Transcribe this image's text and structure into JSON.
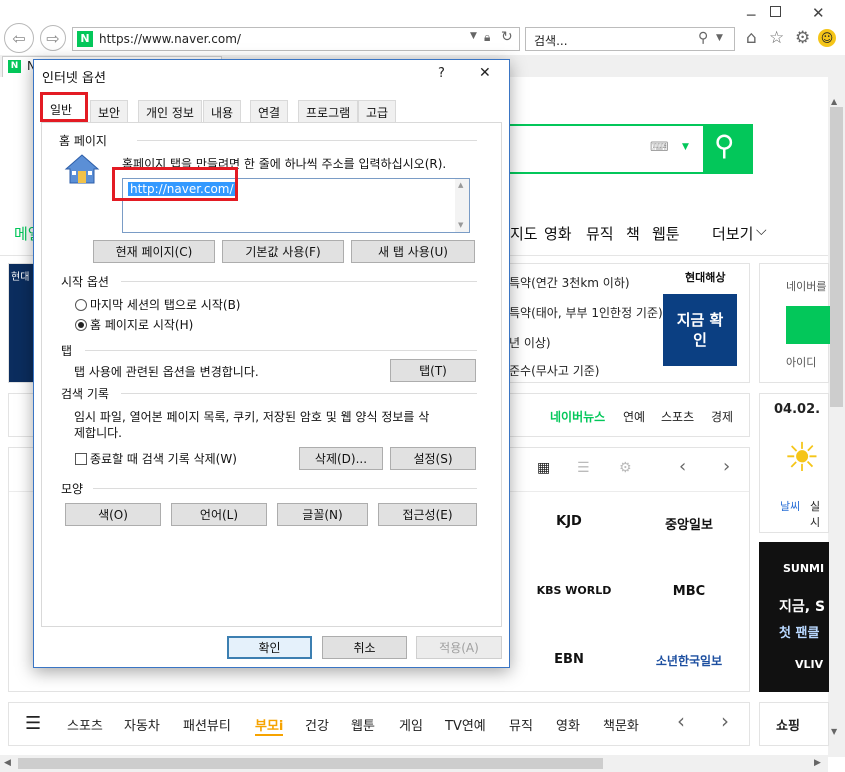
{
  "browser": {
    "address": "https://www.naver.com/",
    "search_placeholder": "검색...",
    "tab_label": "N"
  },
  "page": {
    "nav_items": [
      "메일",
      "지도",
      "영화",
      "뮤직",
      "책",
      "웹툰",
      "더보기"
    ],
    "ad_lines": [
      "특약(연간 3천km 이하)",
      "특약(태아, 부부 1인한정 기준)",
      "년 이상)",
      "준수(무사고 기준)"
    ],
    "ad_brand": "현대해상",
    "ad_button": "지금 확인",
    "ad_side_label": "현대",
    "login_label": "네이버를",
    "login_sub": "아이디",
    "news_tabs": [
      "네이버뉴스",
      "연예",
      "스포츠",
      "경제"
    ],
    "date": "04.02.",
    "weather_label": "날씨",
    "weather_sub": "실시",
    "press_logos": [
      "KJD",
      "중앙일보",
      "KBS WORLD",
      "MBC",
      "EBN",
      "소년한국일보"
    ],
    "sunmi_lines": [
      "SUNMI",
      "지금, S",
      "첫 팬클",
      "VLIV"
    ],
    "bottom_nav": [
      "스포츠",
      "자동차",
      "패션뷰티",
      "부모i",
      "건강",
      "웹툰",
      "게임",
      "TV연예",
      "뮤직",
      "영화",
      "책문화"
    ],
    "bottom_right": "쇼핑",
    "colors": {
      "naver_green": "#03c75a",
      "accent_border": "#e31b23"
    }
  },
  "dialog": {
    "title": "인터넷 옵션",
    "help": "?",
    "close": "✕",
    "tabs": [
      "일반",
      "보안",
      "개인 정보",
      "내용",
      "연결",
      "프로그램",
      "고급"
    ],
    "home": {
      "heading": "홈 페이지",
      "description": "홈페이지 탭을 만들려면 한 줄에 하나씩 주소를 입력하십시오(R).",
      "url": "http://naver.com/",
      "btn_current": "현재 페이지(C)",
      "btn_default": "기본값 사용(F)",
      "btn_newtab": "새 탭 사용(U)"
    },
    "startup": {
      "heading": "시작 옵션",
      "option1": "마지막 세션의 탭으로 시작(B)",
      "option2": "홈 페이지로 시작(H)"
    },
    "tabs_section": {
      "heading": "탭",
      "description": "탭 사용에 관련된 옵션을 변경합니다.",
      "btn": "탭(T)"
    },
    "history": {
      "heading": "검색 기록",
      "description_line1": "임시 파일, 열어본 페이지 목록, 쿠키, 저장된 암호 및 웹 양식 정보를 삭",
      "description_line2": "제합니다.",
      "checkbox": "종료할 때 검색 기록 삭제(W)",
      "btn_delete": "삭제(D)...",
      "btn_settings": "설정(S)"
    },
    "appearance": {
      "heading": "모양",
      "btn_color": "색(O)",
      "btn_language": "언어(L)",
      "btn_font": "글꼴(N)",
      "btn_access": "접근성(E)"
    },
    "footer": {
      "ok": "확인",
      "cancel": "취소",
      "apply": "적용(A)"
    }
  }
}
